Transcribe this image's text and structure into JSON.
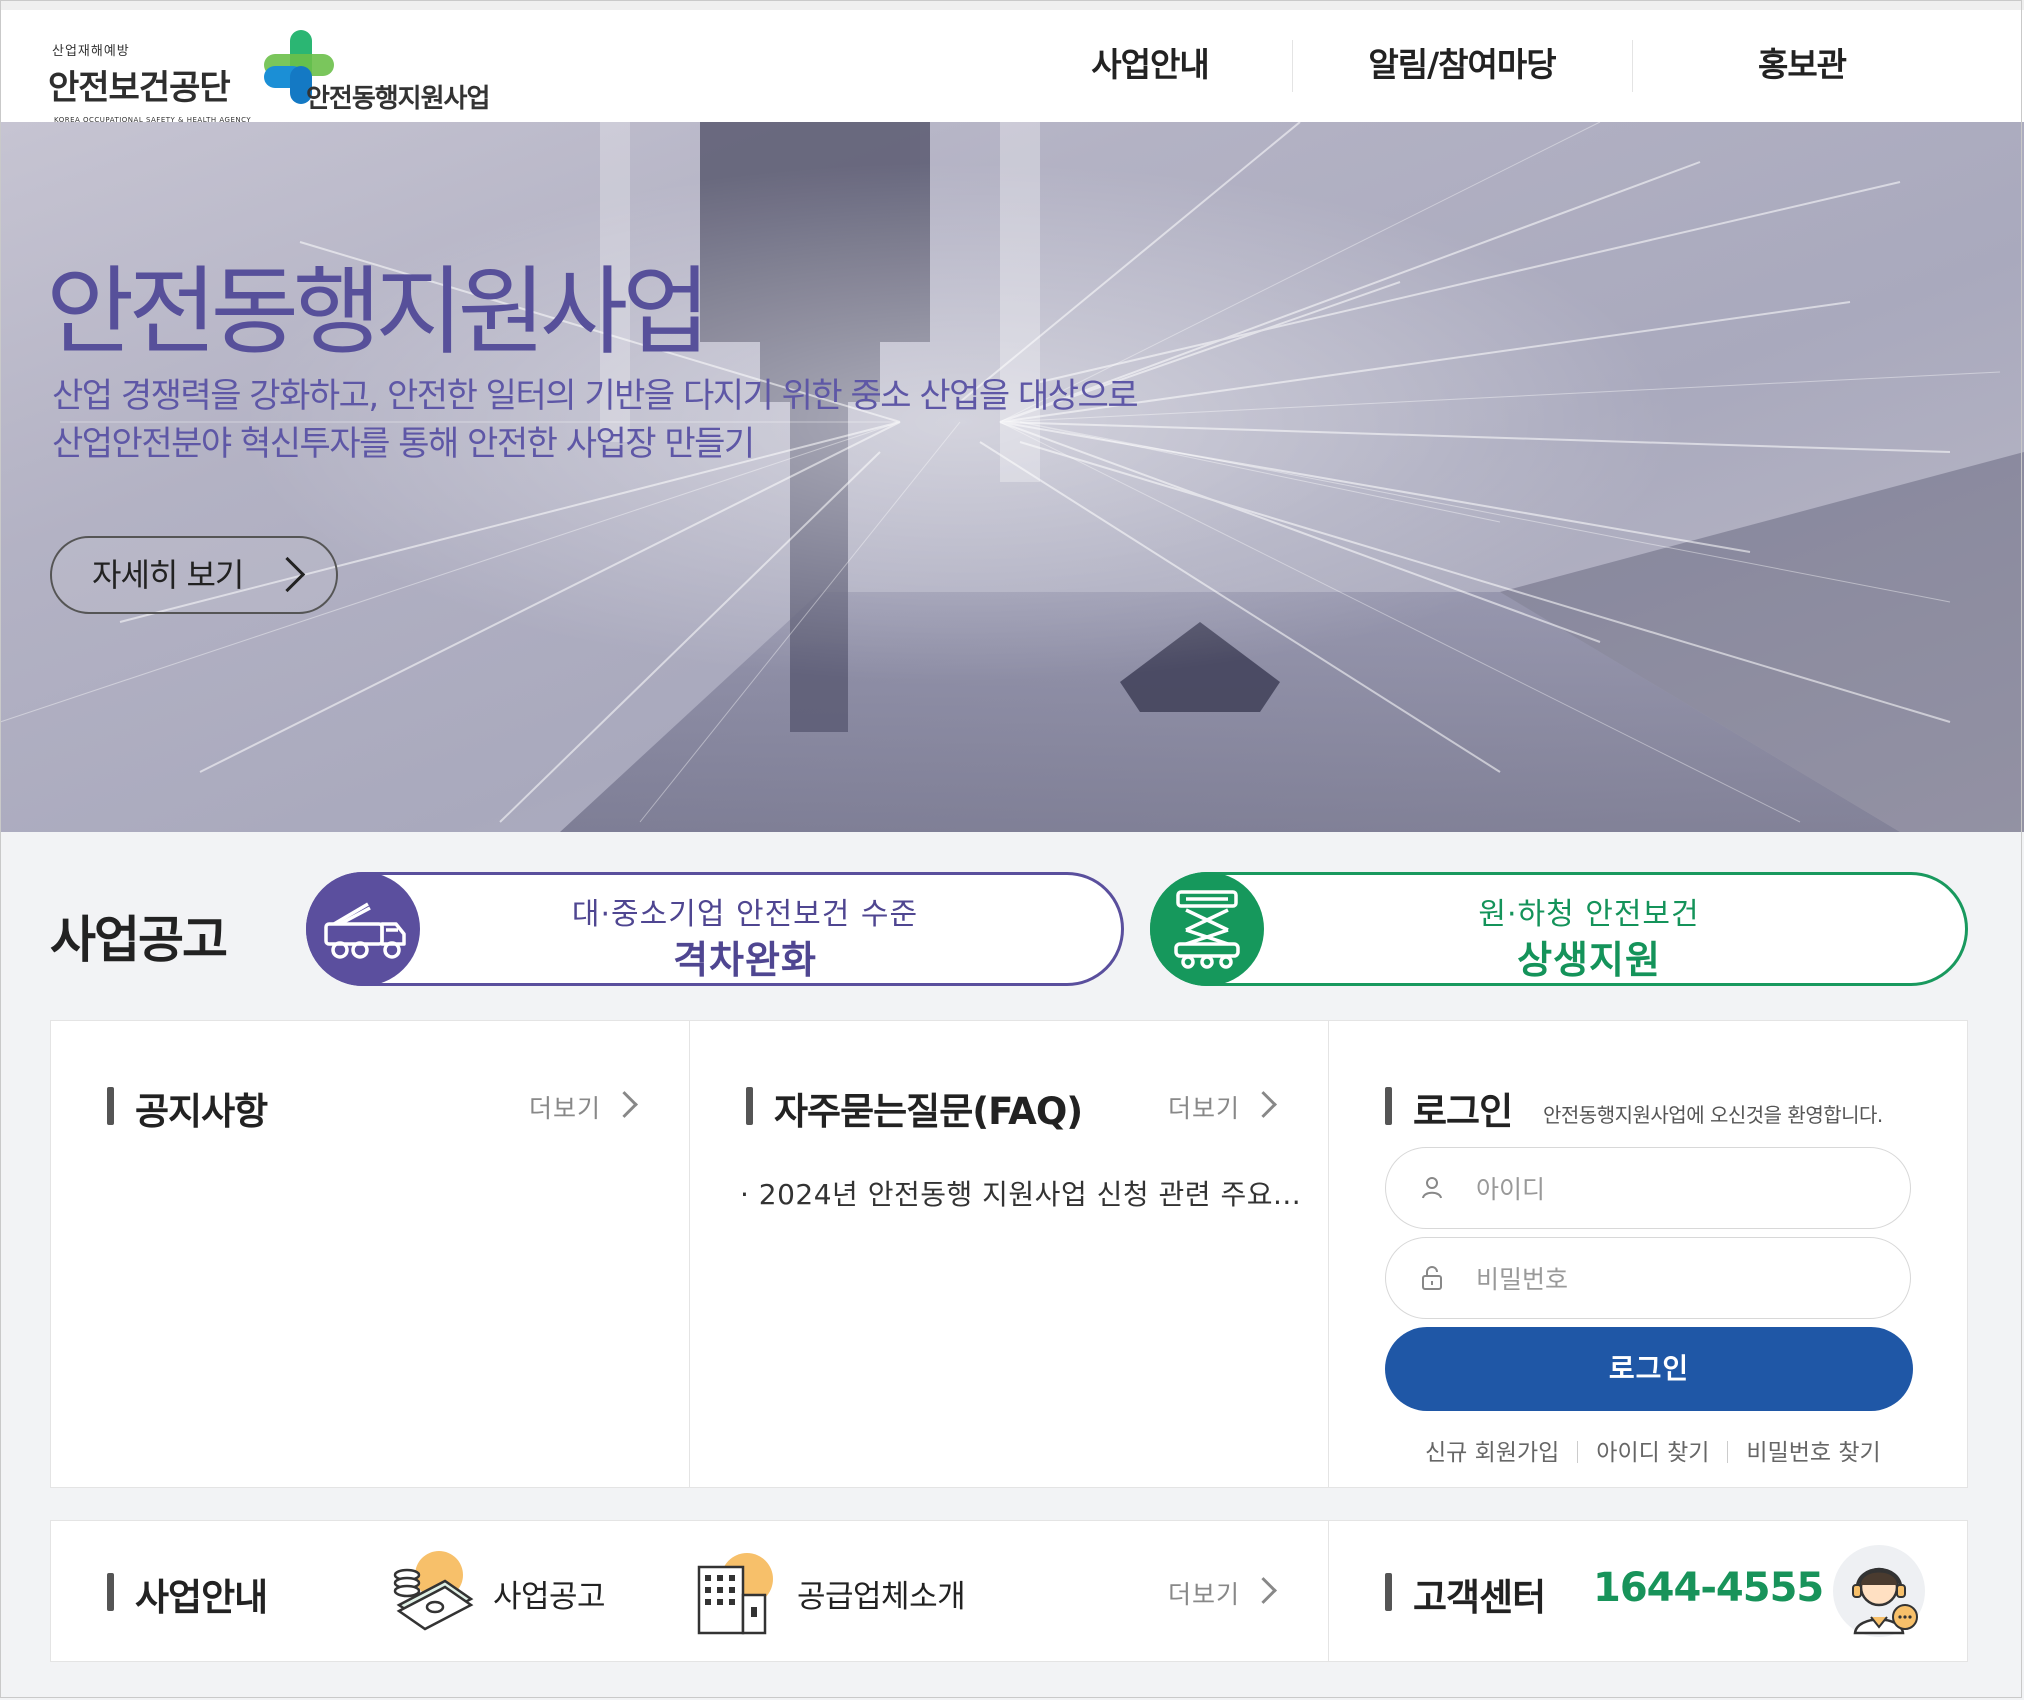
{
  "header": {
    "logo_small": "산업재해예방",
    "logo_main": "안전보건공단",
    "logo_english": "KOREA OCCUPATIONAL SAFETY & HEALTH AGENCY",
    "logo_sub": "안전동행지원사업",
    "nav": [
      "사업안내",
      "알림/참여마당",
      "홍보관"
    ]
  },
  "hero": {
    "title": "안전동행지원사업",
    "desc_line1": "산업 경쟁력을 강화하고, 안전한 일터의 기반을 다지기 위한 중소 산업을 대상으로",
    "desc_line2": "산업안전분야 혁신투자를 통해 안전한 사업장 만들기",
    "button_label": "자세히 보기"
  },
  "announcements": {
    "title": "사업공고",
    "items": [
      {
        "line1": "대·중소기업 안전보건 수준",
        "line2": "격차완화",
        "icon": "truck-crane-icon",
        "color": "#5b4f9e"
      },
      {
        "line1": "원·하청 안전보건",
        "line2": "상생지원",
        "icon": "scissor-lift-icon",
        "color": "#16985c"
      }
    ]
  },
  "notice": {
    "title": "공지사항",
    "more": "더보기"
  },
  "faq": {
    "title": "자주묻는질문(FAQ)",
    "more": "더보기",
    "items": [
      "· 2024년 안전동행 지원사업 신청 관련 주요..."
    ]
  },
  "login": {
    "title": "로그인",
    "welcome": "안전동행지원사업에 오신것을 환영합니다.",
    "id_placeholder": "아이디",
    "pw_placeholder": "비밀번호",
    "button": "로그인",
    "links": [
      "신규 회원가입",
      "아이디 찾기",
      "비밀번호 찾기"
    ]
  },
  "business": {
    "title": "사업안내",
    "links": [
      {
        "label": "사업공고",
        "icon": "money-stack-icon"
      },
      {
        "label": "공급업체소개",
        "icon": "building-icon"
      }
    ],
    "more": "더보기"
  },
  "support": {
    "title": "고객센터",
    "phone": "1644-4555",
    "icon": "call-agent-icon"
  },
  "colors": {
    "purple": "#5b4f9e",
    "green": "#16985c",
    "blue": "#1f57a6",
    "hero_text": "#57509a"
  }
}
